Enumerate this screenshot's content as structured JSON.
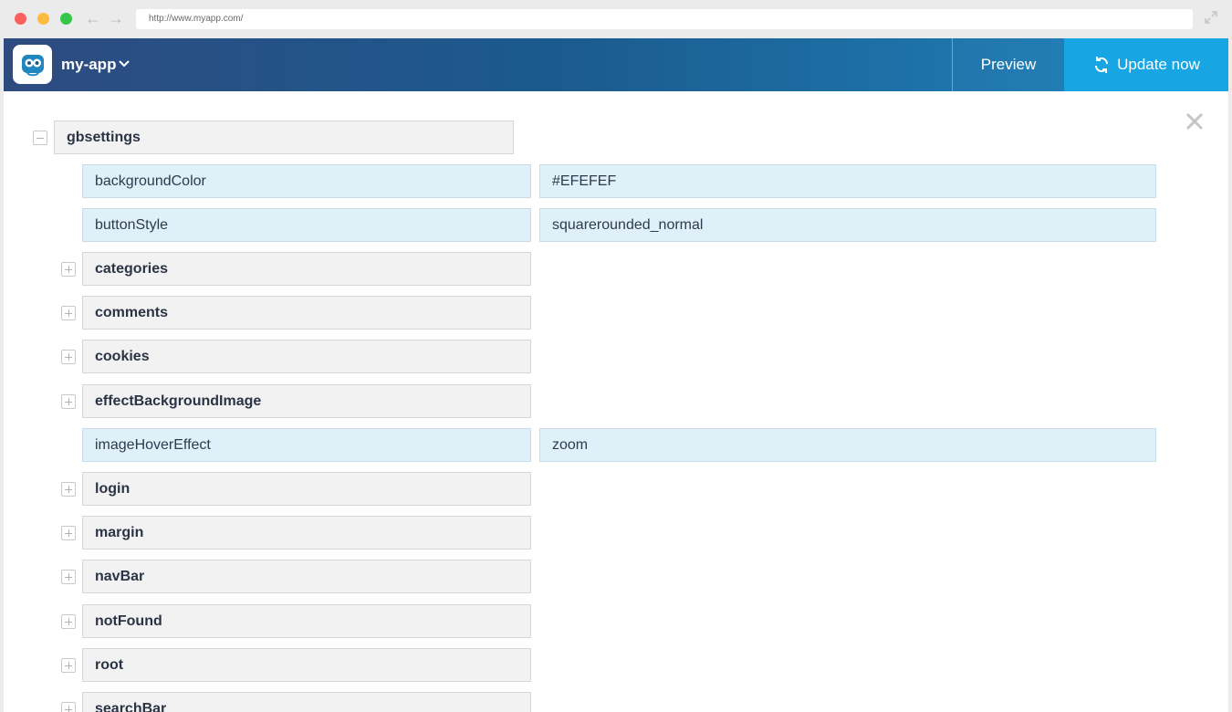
{
  "browser": {
    "url": "http://www.myapp.com/"
  },
  "header": {
    "app_name": "my-app",
    "preview_label": "Preview",
    "update_label": "Update now"
  },
  "tree": {
    "root": {
      "key": "gbsettings",
      "expanded": true
    },
    "items": [
      {
        "key": "backgroundColor",
        "value": "#EFEFEF",
        "type": "leaf"
      },
      {
        "key": "buttonStyle",
        "value": "squarerounded_normal",
        "type": "leaf"
      },
      {
        "key": "categories",
        "type": "group"
      },
      {
        "key": "comments",
        "type": "group"
      },
      {
        "key": "cookies",
        "type": "group"
      },
      {
        "key": "effectBackgroundImage",
        "type": "group"
      },
      {
        "key": "imageHoverEffect",
        "value": "zoom",
        "type": "leaf"
      },
      {
        "key": "login",
        "type": "group"
      },
      {
        "key": "margin",
        "type": "group"
      },
      {
        "key": "navBar",
        "type": "group"
      },
      {
        "key": "notFound",
        "type": "group"
      },
      {
        "key": "root",
        "type": "group"
      },
      {
        "key": "searchBar",
        "type": "group"
      }
    ]
  },
  "colors": {
    "accent": "#17a5e3",
    "leaf_bg": "#dff0f8",
    "group_bg": "#f2f2f2"
  }
}
